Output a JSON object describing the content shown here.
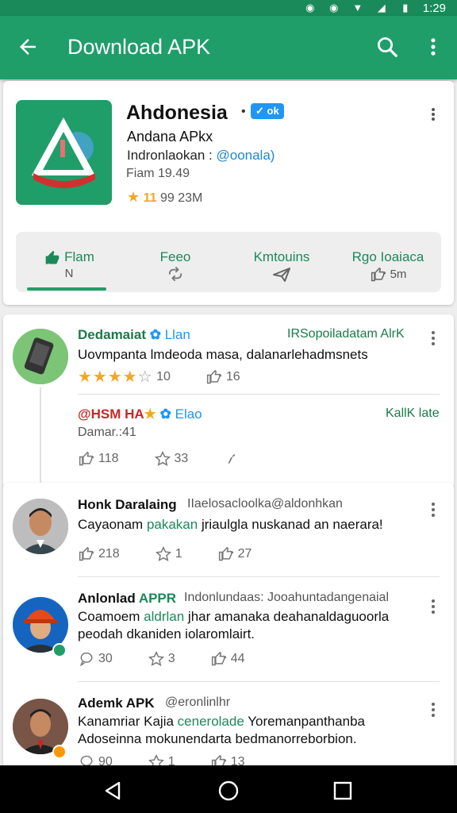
{
  "status_bar": {
    "time": "1:29"
  },
  "appbar": {
    "title": "Download APK"
  },
  "app": {
    "name": "Ahdonesia",
    "badge": "ok",
    "subtitle": "Andana APkx",
    "developer_prefix": "Indronlaokan :",
    "developer_handle": "@oonala)",
    "rating_line": "Fiam 19.49",
    "rating_value": "11",
    "downloads": "99 23M"
  },
  "actions": [
    {
      "label": "Flam",
      "sub": "N"
    },
    {
      "label": "Feeo",
      "sub": ""
    },
    {
      "label": "Kmtouins",
      "sub": ""
    },
    {
      "label": "Rgo Ioaiaca",
      "sub": "5m"
    }
  ],
  "reviews_top": {
    "name": "Dedamaiat",
    "tag": "Llan",
    "meta": "IRSopoiladatam AlrK",
    "text": "Uovmpanta lmdeoda masa, dalanarlehadmsnets",
    "rating_count": "10",
    "likes": "16",
    "reply": {
      "name": "@HSM HA",
      "tag": "Elao",
      "meta": "KallK late",
      "subtext": "Damar.:41",
      "likes": "118",
      "stars": "33"
    }
  },
  "reviews": [
    {
      "name": "Honk Daralaing",
      "meta": "IIaelosacloolka@aldonhkan",
      "text_pre": "Cayaonam ",
      "text_hl": "pakakan",
      "text_post": " jriaulgla nuskanad an naerara!",
      "likes": "218",
      "stars": "1",
      "replies": "27"
    },
    {
      "name": "Anlonlad",
      "name_hl": "APPR",
      "meta": "Indonlundaas: Jooahuntadangenaial",
      "text_pre": "Coamoem ",
      "text_hl": "aldrlan",
      "text_post": " jhar amanaka deahanaldaguoorla",
      "text_line2": "peodah dkaniden iolaromlairt.",
      "likes": "30",
      "stars": "3",
      "replies": "44"
    },
    {
      "name": "Ademk APK",
      "meta": "@eronlinlhr",
      "text_pre": "Kanamriar Kajia ",
      "text_hl": "cenerolade",
      "text_post": " Yoremanpanthanba",
      "text_line2": "Adoseinna mokunendarta bedmanorreborbion.",
      "likes": "90",
      "stars": "1",
      "replies": "13"
    }
  ],
  "colors": {
    "primary": "#1f9e6a",
    "accent": "#2196f3",
    "star": "#f4a623"
  }
}
